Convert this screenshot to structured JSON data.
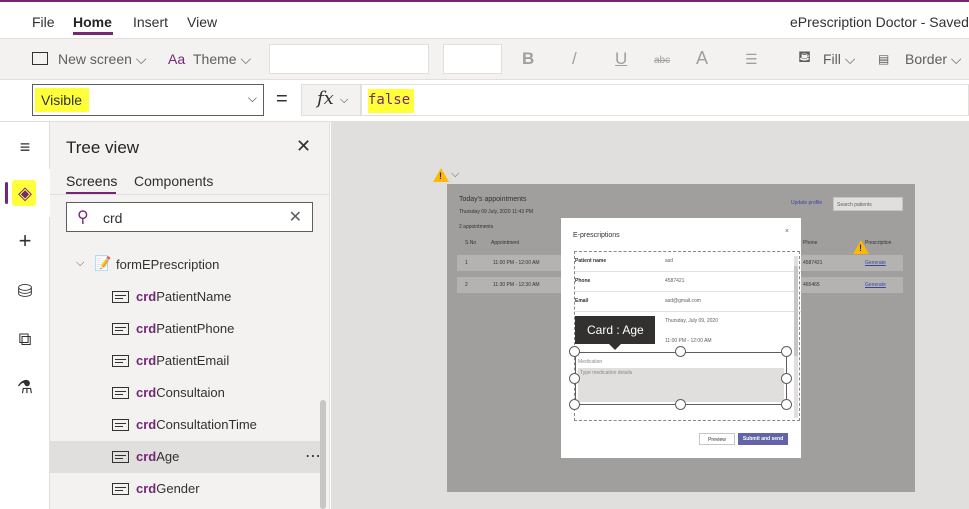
{
  "menu": {
    "items": [
      "File",
      "Home",
      "Insert",
      "View"
    ],
    "active": "Home",
    "app_title": "ePrescription Doctor - Saved"
  },
  "ribbon": {
    "new_screen": "New screen",
    "theme": "Theme",
    "fill": "Fill",
    "border": "Border",
    "bold_glyph": "B",
    "italic_glyph": "/",
    "underline_glyph": "U",
    "strike_glyph": "abc",
    "font_size_glyph": "A",
    "chevron": "⌵"
  },
  "formula": {
    "property": "Visible",
    "equals": "=",
    "fx": "fx",
    "value": "false"
  },
  "tree": {
    "title": "Tree view",
    "tabs": [
      "Screens",
      "Components"
    ],
    "search_value": "crd",
    "parent": "formEPrescription",
    "items": [
      {
        "prefix": "crd",
        "rest": "PatientName"
      },
      {
        "prefix": "crd",
        "rest": "PatientPhone"
      },
      {
        "prefix": "crd",
        "rest": "PatientEmail"
      },
      {
        "prefix": "crd",
        "rest": "Consultaion"
      },
      {
        "prefix": "crd",
        "rest": "ConsultationTime"
      },
      {
        "prefix": "crd",
        "rest": "Age"
      },
      {
        "prefix": "crd",
        "rest": "Gender"
      }
    ],
    "more": "⋯"
  },
  "canvas": {
    "screen_title": "Today's appointments",
    "screen_date": "Thursday 09 July, 2020  11:43 PM",
    "count": "2 appointments",
    "update_profile": "Update profile",
    "search_placeholder": "Search patients",
    "headers": [
      "S.No",
      "Appointment",
      "Phone",
      "Prescription"
    ],
    "rows": [
      {
        "sno": "1",
        "appt": "11:00 PM - 12:00 AM",
        "phone": "4587421",
        "action": "Generate"
      },
      {
        "sno": "2",
        "appt": "11:30 PM - 12:30 AM",
        "phone": "465465",
        "action": "Generate"
      }
    ],
    "modal": {
      "title": "E-prescriptions",
      "close": "×",
      "fields": [
        {
          "label": "Patient name",
          "value": "asd"
        },
        {
          "label": "Phone",
          "value": "4587421"
        },
        {
          "label": "Email",
          "value": "asd@gmail.com"
        },
        {
          "label": "",
          "value": "Thursday, July 09, 2020"
        },
        {
          "label": "",
          "value": "11:00 PM - 12:00 AM"
        }
      ],
      "medication_label": "Medication",
      "medication_placeholder": "Type medication details",
      "tooltip": "Card : Age",
      "preview": "Preview",
      "submit": "Submit and send"
    }
  },
  "colors": {
    "accent": "#742774",
    "highlight": "#ffff3a",
    "warning": "#ffb900",
    "primary_button": "#6264a7"
  }
}
